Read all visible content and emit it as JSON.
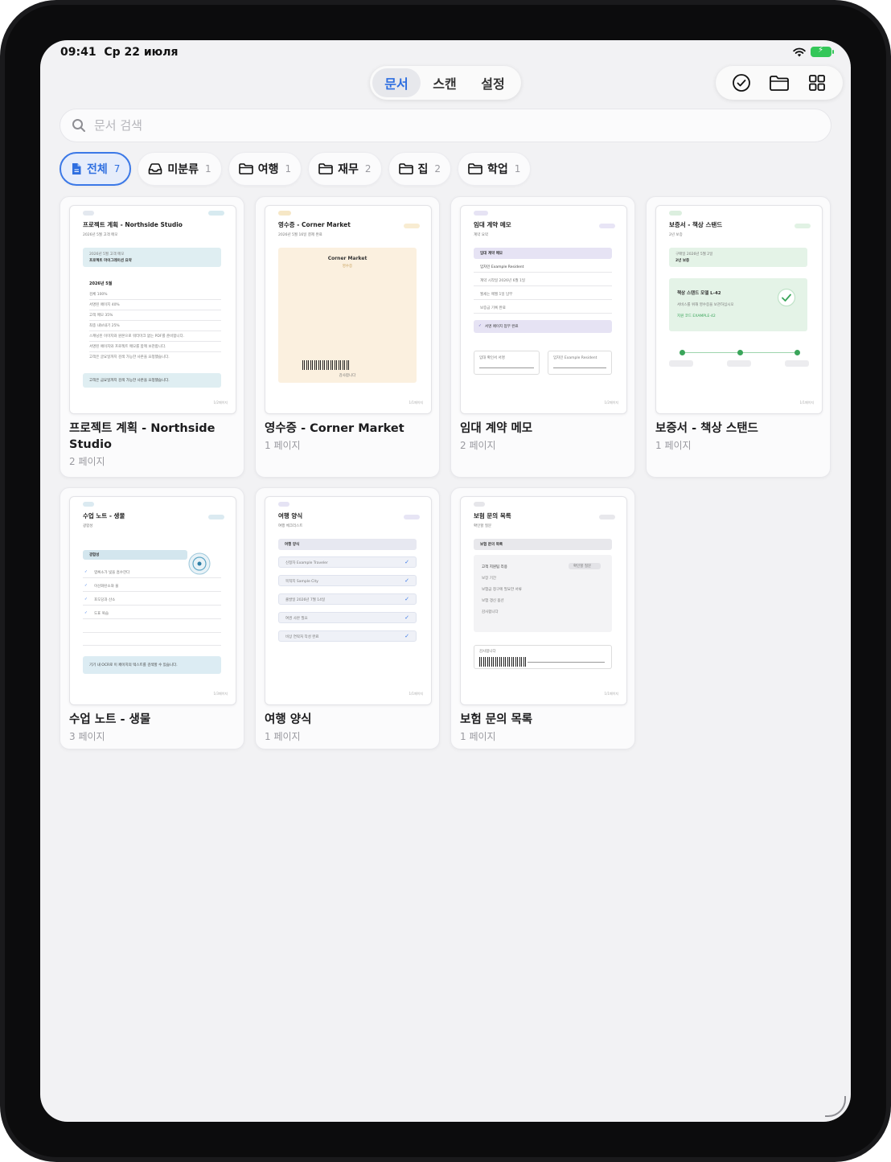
{
  "status": {
    "time": "09:41",
    "date": "Ср 22 июля"
  },
  "tabs": [
    {
      "label": "문서",
      "active": true
    },
    {
      "label": "스캔"
    },
    {
      "label": "설정"
    }
  ],
  "toolbar": {
    "icons": [
      "checkmark-circle-icon",
      "folder-icon",
      "grid-icon"
    ]
  },
  "search": {
    "placeholder": "문서 검색"
  },
  "chips": [
    {
      "label": "전체",
      "count": "7",
      "icon": "document-icon",
      "active": true
    },
    {
      "label": "미분류",
      "count": "1",
      "icon": "tray-icon"
    },
    {
      "label": "여행",
      "count": "1",
      "icon": "folder-icon"
    },
    {
      "label": "재무",
      "count": "2",
      "icon": "folder-icon"
    },
    {
      "label": "집",
      "count": "2",
      "icon": "folder-icon"
    },
    {
      "label": "학업",
      "count": "1",
      "icon": "folder-icon"
    }
  ],
  "documents": [
    {
      "title": "프로젝트 계획 - Northside Studio",
      "pages": "2 페이지",
      "thumb": {
        "heading": "프로젝트 계획 - Northside Studio",
        "date": "2026년 5월 고객 메모",
        "box_label": "2026년 5월 고객 메모",
        "box_title": "프로젝트 마이그레이션 요약",
        "section": "2026년 5월",
        "lines": [
          "검체 100%",
          "서명된 페이지 40%",
          "고객 메모 35%",
          "최종 내보내기 25%",
          "스캐닝된 이미지와 원본으로 워터마크 없는 PDF를 준비합니다.",
          "서명된 페이지와 프로젝트 메모를 함께 보관합니다.",
          "고객은 글요일까지 검색 가능한 사본을 요청했습니다."
        ],
        "note": "고객은 금요일까지 검색 가능한 사본을 요청했습니다.",
        "footer": "1/2페이지"
      }
    },
    {
      "title": "영수증 - Corner Market",
      "pages": "1 페이지",
      "thumb": {
        "heading": "영수증 - Corner Market",
        "date": "2026년 5월 16일 결제 완료",
        "store": "Corner Market",
        "store_sub": "영수증",
        "barcode_label": "감사합니다",
        "footer": "1/1페이지"
      }
    },
    {
      "title": "임대 계약 메모",
      "pages": "2 페이지",
      "thumb": {
        "heading": "임대 계약 메모",
        "date": "계약 요약",
        "box_title": "임대 계약 메모",
        "lines": [
          "임차인 Example Resident",
          "계약 시작일 2026년 6월 1일",
          "월세는 매월 1일 납부",
          "보증금 기록 완료"
        ],
        "check": "서명 페이지 첨부 완료",
        "sig1": "임대 확인서 서명",
        "sig2": "임차인 Example Resident",
        "footer": "1/2페이지"
      }
    },
    {
      "title": "보증서 - 책상 스탠드",
      "pages": "1 페이지",
      "thumb": {
        "heading": "보증서 - 책상 스탠드",
        "date": "2년 보증",
        "box_label": "구매일 2026년 5월 2일",
        "box_title": "2년 보증",
        "product": "책상 스탠드 모델 L-42",
        "product_sub": "서비스를 위해 영수증을 보관하십시오",
        "serial": "지원 코드 EXAMPLE-42",
        "footer": "1/1페이지"
      }
    },
    {
      "title": "수업 노트 - 생물",
      "pages": "3 페이지",
      "thumb": {
        "heading": "수업 노트 - 생물",
        "date": "광합성",
        "section": "광합성",
        "lines": [
          "엽록소가 빛을 흡수한다",
          "이산화탄소와 물",
          "포도당과 산소",
          "도표 복습"
        ],
        "note": "기기 내 OCR로 이 페이지의 텍스트를 검색할 수 있습니다.",
        "footer": "1/3페이지"
      }
    },
    {
      "title": "여행 양식",
      "pages": "1 페이지",
      "thumb": {
        "heading": "여행 양식",
        "date": "여행 체크리스트",
        "box_title": "여행 양식",
        "lines": [
          "신청자 Example Traveler",
          "목적지 Sample City",
          "출발일 2026년 7월 14일",
          "여권 사본 필요",
          "비상 연락처 작성 완료"
        ],
        "footer": "1/1페이지"
      }
    },
    {
      "title": "보험 문의 목록",
      "pages": "1 페이지",
      "thumb": {
        "heading": "보험 문의 목록",
        "date": "확인할 질문",
        "box_title": "보험 문의 목록",
        "lines": [
          "고객 지원팀 리용",
          "보장 기간",
          "보험금 청구에 필요한 서류",
          "보험 갱신 옵션",
          "감사합니다"
        ],
        "badge": "확인할 질문",
        "barcode_label": "감사합니다",
        "footer": "1/1페이지"
      }
    }
  ]
}
